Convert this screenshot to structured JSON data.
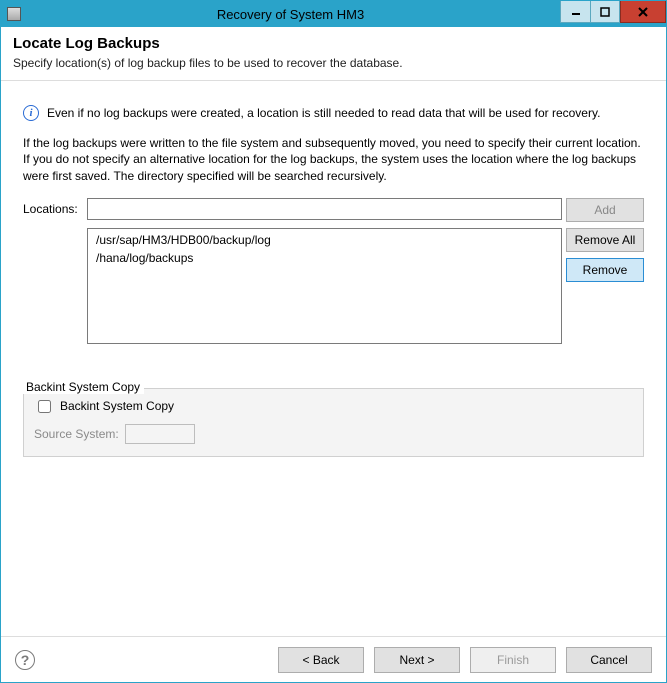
{
  "window": {
    "title": "Recovery of System HM3"
  },
  "header": {
    "heading": "Locate Log Backups",
    "subtitle": "Specify location(s) of log backup files to be used to recover the database."
  },
  "info": {
    "text": "Even if no log backups were created, a location is still needed to read data that will be used for recovery."
  },
  "explain": {
    "text": "If the log backups were written to the file system and subsequently moved, you need to specify their current location. If you do not specify an alternative location for the log backups, the system uses the location where the log backups were first saved. The directory specified will be searched recursively."
  },
  "locations": {
    "label": "Locations:",
    "input_value": "",
    "items": [
      "/usr/sap/HM3/HDB00/backup/log",
      "/hana/log/backups"
    ],
    "buttons": {
      "add": "Add",
      "remove_all": "Remove All",
      "remove": "Remove"
    }
  },
  "backint": {
    "legend": "Backint System Copy",
    "checkbox_label": "Backint System Copy",
    "source_label": "Source System:",
    "source_value": ""
  },
  "footer": {
    "back": "< Back",
    "next": "Next >",
    "finish": "Finish",
    "cancel": "Cancel"
  }
}
